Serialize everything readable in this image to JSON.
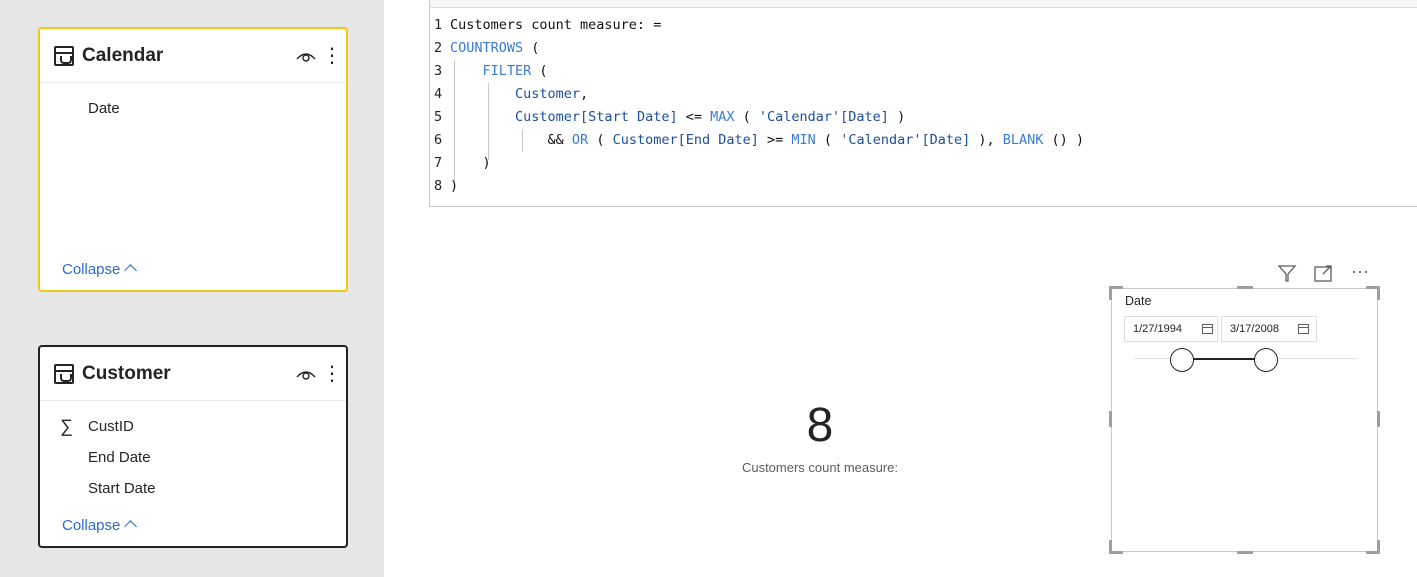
{
  "model": {
    "tables": [
      {
        "name": "Calendar",
        "fields": [
          {
            "name": "Date",
            "icon": ""
          }
        ],
        "collapse_label": "Collapse"
      },
      {
        "name": "Customer",
        "fields": [
          {
            "name": "CustID",
            "icon": "sigma-icon"
          },
          {
            "name": "End Date",
            "icon": ""
          },
          {
            "name": "Start Date",
            "icon": ""
          }
        ],
        "collapse_label": "Collapse"
      }
    ]
  },
  "editor": {
    "lines": [
      {
        "num": "1",
        "tokens": [
          {
            "t": "Customers count measure: =",
            "c": "plain"
          }
        ]
      },
      {
        "num": "2",
        "tokens": [
          {
            "t": "COUNTROWS",
            "c": "kw"
          },
          {
            "t": " (",
            "c": "plain"
          }
        ]
      },
      {
        "num": "3",
        "tokens": [
          {
            "t": "    ",
            "c": "plain"
          },
          {
            "t": "FILTER",
            "c": "kw"
          },
          {
            "t": " (",
            "c": "plain"
          }
        ]
      },
      {
        "num": "4",
        "tokens": [
          {
            "t": "        ",
            "c": "plain"
          },
          {
            "t": "Customer",
            "c": "id"
          },
          {
            "t": ",",
            "c": "plain"
          }
        ]
      },
      {
        "num": "5",
        "tokens": [
          {
            "t": "        ",
            "c": "plain"
          },
          {
            "t": "Customer[Start Date]",
            "c": "id"
          },
          {
            "t": " <= ",
            "c": "plain"
          },
          {
            "t": "MAX",
            "c": "kw"
          },
          {
            "t": " ( ",
            "c": "plain"
          },
          {
            "t": "'Calendar'[Date]",
            "c": "str"
          },
          {
            "t": " )",
            "c": "plain"
          }
        ]
      },
      {
        "num": "6",
        "tokens": [
          {
            "t": "            && ",
            "c": "plain"
          },
          {
            "t": "OR",
            "c": "kw"
          },
          {
            "t": " ( ",
            "c": "plain"
          },
          {
            "t": "Customer[End Date]",
            "c": "id"
          },
          {
            "t": " >= ",
            "c": "plain"
          },
          {
            "t": "MIN",
            "c": "kw"
          },
          {
            "t": " ( ",
            "c": "plain"
          },
          {
            "t": "'Calendar'[Date]",
            "c": "str"
          },
          {
            "t": " ), ",
            "c": "plain"
          },
          {
            "t": "BLANK",
            "c": "kw"
          },
          {
            "t": " () )",
            "c": "plain"
          }
        ]
      },
      {
        "num": "7",
        "tokens": [
          {
            "t": "    )",
            "c": "plain"
          }
        ]
      },
      {
        "num": "8",
        "tokens": [
          {
            "t": ")",
            "c": "plain"
          }
        ]
      }
    ]
  },
  "card_visual": {
    "value": "8",
    "label": "Customers count measure:"
  },
  "slicer": {
    "title": "Date",
    "start_date": "1/27/1994",
    "end_date": "3/17/2008",
    "header_icons": [
      "filter-icon",
      "focus-mode-icon",
      "more-options-icon"
    ],
    "more_label": "···"
  },
  "colors": {
    "selected_table_border": "#f2c811",
    "link": "#2b6cc4",
    "keyword": "#3a7bd5",
    "identifier": "#1c4f9c"
  }
}
